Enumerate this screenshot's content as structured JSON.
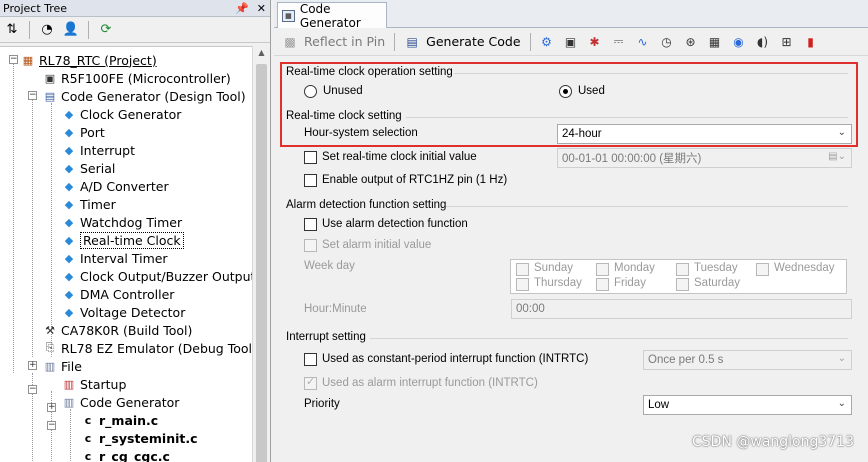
{
  "project_tree": {
    "title": "Project Tree",
    "pin_glyph": "⊕",
    "close_glyph": "✕",
    "toolbar_icons": [
      "sort-icon",
      "properties-icon",
      "user-icon",
      "refresh-icon"
    ],
    "items": [
      {
        "label": "RL78_RTC (Project)",
        "icon": "project-icon",
        "underline": true
      },
      {
        "label": "R5F100FE (Microcontroller)",
        "icon": "chip-icon"
      },
      {
        "label": "Code Generator (Design Tool)",
        "icon": "design-tool-icon"
      },
      {
        "label": "Clock Generator",
        "icon": "module-icon"
      },
      {
        "label": "Port",
        "icon": "module-icon"
      },
      {
        "label": "Interrupt",
        "icon": "module-icon"
      },
      {
        "label": "Serial",
        "icon": "module-icon"
      },
      {
        "label": "A/D Converter",
        "icon": "module-icon"
      },
      {
        "label": "Timer",
        "icon": "module-icon"
      },
      {
        "label": "Watchdog Timer",
        "icon": "module-icon"
      },
      {
        "label": "Real-time Clock",
        "icon": "module-icon",
        "selected": true
      },
      {
        "label": "Interval Timer",
        "icon": "module-icon"
      },
      {
        "label": "Clock Output/Buzzer Output",
        "icon": "module-icon"
      },
      {
        "label": "DMA Controller",
        "icon": "module-icon"
      },
      {
        "label": "Voltage Detector",
        "icon": "module-icon"
      },
      {
        "label": "CA78K0R (Build Tool)",
        "icon": "hammer-icon"
      },
      {
        "label": "RL78 EZ Emulator (Debug Tool)",
        "icon": "debugger-icon"
      },
      {
        "label": "File",
        "icon": "folder-icon"
      },
      {
        "label": "Startup",
        "icon": "startup-folder-icon"
      },
      {
        "label": "Code Generator",
        "icon": "folder-icon"
      },
      {
        "label": "r_main.c",
        "icon": "c-file-icon",
        "bold": true
      },
      {
        "label": "r_systeminit.c",
        "icon": "c-file-icon",
        "bold": true
      },
      {
        "label": "r_cg_cgc.c",
        "icon": "c-file-icon",
        "bold": true
      }
    ]
  },
  "editor": {
    "tab_label": "Code Generator",
    "toolbar": {
      "reflect_in_pin": "Reflect in Pin",
      "generate_code": "Generate Code",
      "icons": [
        "clock-tree-icon",
        "port-icon",
        "interrupt-icon",
        "serial-icon",
        "adc-icon",
        "timer-icon",
        "watchdog-icon",
        "rtc-icon",
        "interval-timer-icon",
        "buzzer-icon",
        "dma-icon",
        "voltage-detector-icon"
      ]
    },
    "rtc_operation": {
      "legend": "Real-time clock operation setting",
      "unused_label": "Unused",
      "used_label": "Used",
      "selected": "Used"
    },
    "rtc_setting": {
      "legend": "Real-time clock setting",
      "hour_system_label": "Hour-system selection",
      "hour_system_value": "24-hour",
      "set_initial_label": "Set real-time clock initial value",
      "initial_value": "00-01-01 00:00:00 (星期六)",
      "enable_rtc1hz_label": "Enable output of RTC1HZ pin (1 Hz)"
    },
    "alarm": {
      "legend": "Alarm detection function setting",
      "use_alarm_label": "Use alarm detection function",
      "set_alarm_initial_label": "Set alarm initial value",
      "week_day_label": "Week day",
      "days": [
        "Sunday",
        "Monday",
        "Tuesday",
        "Wednesday",
        "Thursday",
        "Friday",
        "Saturday"
      ],
      "hour_minute_label": "Hour:Minute",
      "hour_minute_value": "00:00"
    },
    "interrupt": {
      "legend": "Interrupt setting",
      "constant_period_label": "Used as constant-period interrupt function (INTRTC)",
      "constant_period_value": "Once per 0.5 s",
      "alarm_interrupt_label": "Used as alarm interrupt function (INTRTC)",
      "priority_label": "Priority",
      "priority_value": "Low"
    },
    "highlight_color": "#e0302e"
  },
  "watermark": "CSDN @wanglong3713"
}
